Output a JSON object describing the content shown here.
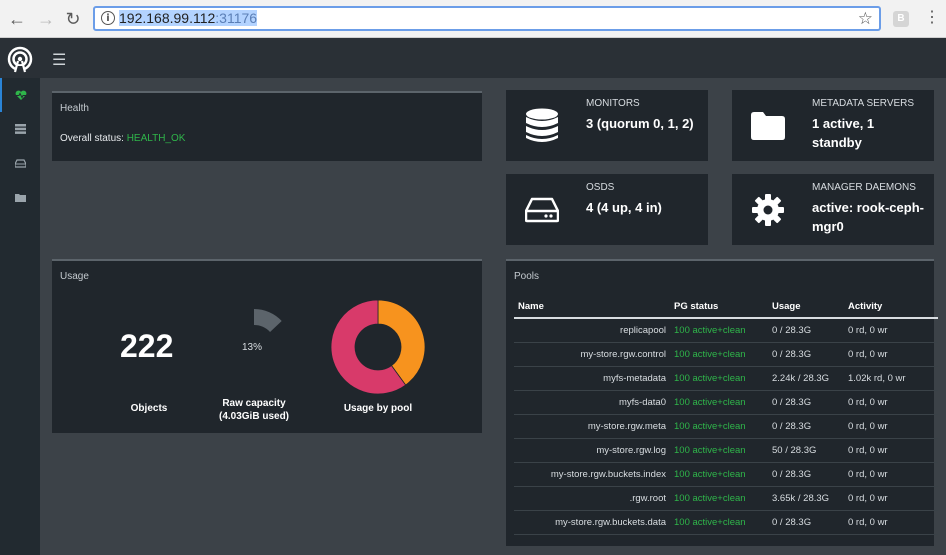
{
  "browser": {
    "url_host": "192.168.99.112",
    "url_port": ":31176",
    "extension_badge": "B"
  },
  "health": {
    "title": "Health",
    "status_label": "Overall status:",
    "status_value": "HEALTH_OK"
  },
  "monitors": {
    "label": "MONITORS",
    "value": "3 (quorum 0, 1, 2)"
  },
  "metadata": {
    "label": "METADATA SERVERS",
    "value_line1": "1 active, 1",
    "value_line2": "standby"
  },
  "osds": {
    "label": "OSDS",
    "value": "4 (4 up, 4 in)"
  },
  "manager": {
    "label": "MANAGER DAEMONS",
    "value_line1": "active: rook-ceph-",
    "value_line2": "mgr0"
  },
  "usage": {
    "title": "Usage",
    "objects_value": "222",
    "objects_label": "Objects",
    "raw_percent": "13%",
    "raw_fraction": 0.13,
    "raw_label_line1": "Raw capacity",
    "raw_label_line2": "(4.03GiB used)",
    "pool_label": "Usage by pool",
    "pool_fractions": [
      0.4,
      0.6
    ],
    "pool_colors": [
      "#f7931e",
      "#d83a6a"
    ]
  },
  "pools": {
    "title": "Pools",
    "headers": {
      "name": "Name",
      "pg": "PG status",
      "usage": "Usage",
      "activity": "Activity"
    },
    "rows": [
      {
        "name": "replicapool",
        "pg": "100 active+clean",
        "usage": "0 / 28.3G",
        "activity": "0 rd, 0 wr"
      },
      {
        "name": "my-store.rgw.control",
        "pg": "100 active+clean",
        "usage": "0 / 28.3G",
        "activity": "0 rd, 0 wr"
      },
      {
        "name": "myfs-metadata",
        "pg": "100 active+clean",
        "usage": "2.24k / 28.3G",
        "activity": "1.02k rd, 0 wr"
      },
      {
        "name": "myfs-data0",
        "pg": "100 active+clean",
        "usage": "0 / 28.3G",
        "activity": "0 rd, 0 wr"
      },
      {
        "name": "my-store.rgw.meta",
        "pg": "100 active+clean",
        "usage": "0 / 28.3G",
        "activity": "0 rd, 0 wr"
      },
      {
        "name": "my-store.rgw.log",
        "pg": "100 active+clean",
        "usage": "50 / 28.3G",
        "activity": "0 rd, 0 wr"
      },
      {
        "name": "my-store.rgw.buckets.index",
        "pg": "100 active+clean",
        "usage": "0 / 28.3G",
        "activity": "0 rd, 0 wr"
      },
      {
        "name": ".rgw.root",
        "pg": "100 active+clean",
        "usage": "3.65k / 28.3G",
        "activity": "0 rd, 0 wr"
      },
      {
        "name": "my-store.rgw.buckets.data",
        "pg": "100 active+clean",
        "usage": "0 / 28.3G",
        "activity": "0 rd, 0 wr"
      }
    ]
  },
  "icons": {
    "sidebar": [
      "health-icon",
      "servers-icon",
      "drive-icon",
      "folder-icon"
    ]
  }
}
